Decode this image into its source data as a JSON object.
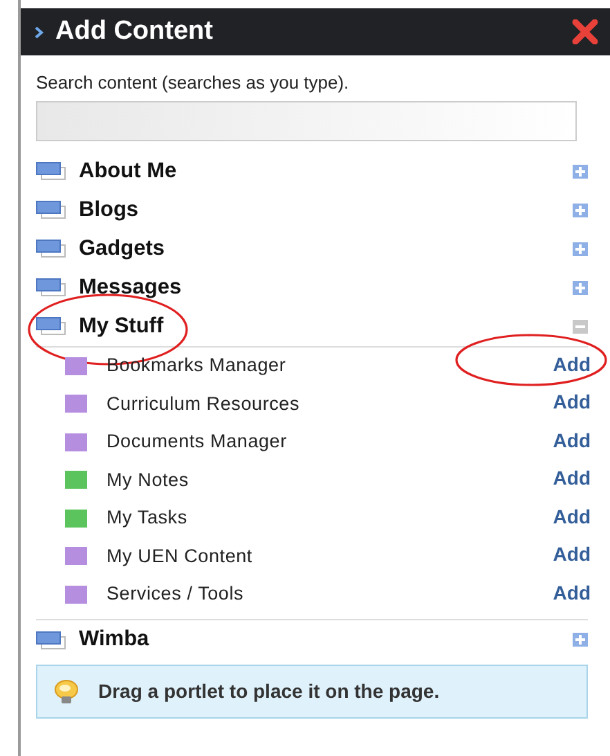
{
  "panel": {
    "title": "Add Content"
  },
  "search": {
    "label": "Search content (searches as you type)."
  },
  "categories": [
    {
      "name": "About Me",
      "expanded": false,
      "circled": false
    },
    {
      "name": "Blogs",
      "expanded": false,
      "circled": false
    },
    {
      "name": "Gadgets",
      "expanded": false,
      "circled": false
    },
    {
      "name": "Messages",
      "expanded": false,
      "circled": false
    },
    {
      "name": "My Stuff",
      "expanded": true,
      "circled": true,
      "children": [
        {
          "name": "Bookmarks Manager",
          "color": "#b58ee0",
          "action": "Add",
          "circled": true
        },
        {
          "name": "Curriculum Resources",
          "color": "#b58ee0",
          "action": "Add",
          "circled": false
        },
        {
          "name": "Documents Manager",
          "color": "#b58ee0",
          "action": "Add",
          "circled": false
        },
        {
          "name": "My Notes",
          "color": "#5cc45c",
          "action": "Add",
          "circled": false
        },
        {
          "name": "My Tasks",
          "color": "#5cc45c",
          "action": "Add",
          "circled": false
        },
        {
          "name": "My UEN Content",
          "color": "#b58ee0",
          "action": "Add",
          "circled": false
        },
        {
          "name": "Services / Tools",
          "color": "#b58ee0",
          "action": "Add",
          "circled": false
        }
      ]
    },
    {
      "name": "Wimba",
      "expanded": false,
      "circled": false
    }
  ],
  "tip": {
    "text": "Drag a portlet to place it on the page."
  }
}
